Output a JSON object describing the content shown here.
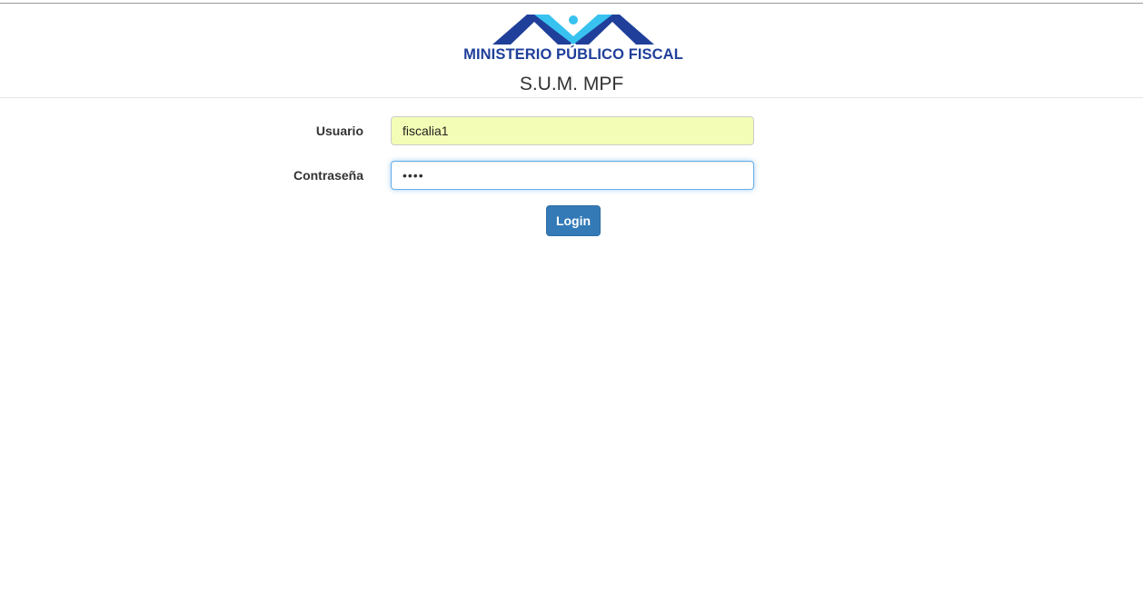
{
  "header": {
    "logo_text": "MINISTERIO PÚBLICO FISCAL",
    "app_title": "S.U.M. MPF",
    "logo_colors": {
      "dark": "#1f3f9a",
      "light": "#38c2ef"
    }
  },
  "form": {
    "username": {
      "label": "Usuario",
      "value": "fiscalia1"
    },
    "password": {
      "label": "Contraseña",
      "value": "••••"
    },
    "submit_label": "Login"
  },
  "colors": {
    "primary_button": "#337ab7",
    "autofill_background": "#f4fdb5",
    "focus_border": "#66afe9"
  }
}
